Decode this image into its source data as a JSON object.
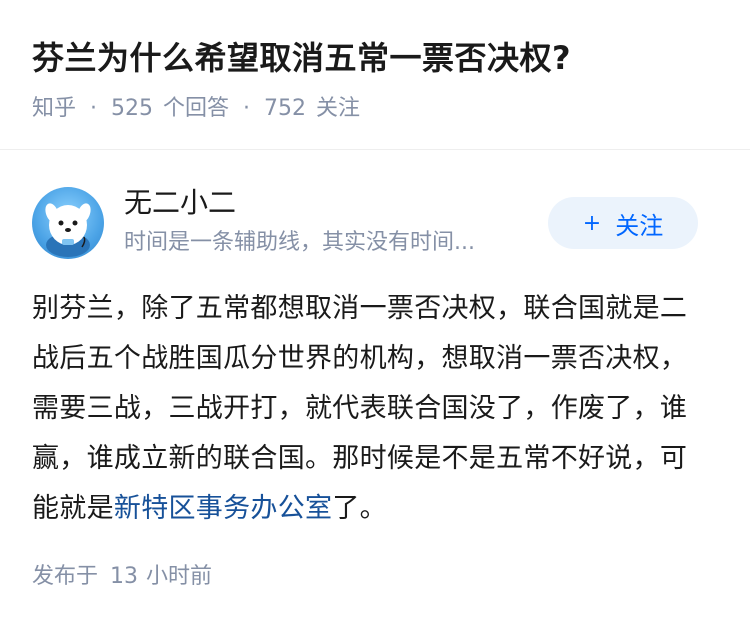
{
  "question": {
    "title": "芬兰为什么希望取消五常一票否决权?",
    "source": "知乎",
    "answer_count": "525",
    "answer_label": "个回答",
    "follow_count": "752",
    "follow_label": "关注",
    "separator": "·"
  },
  "author": {
    "name": "无二小二",
    "bio": "时间是一条辅助线，其实没有时间...",
    "avatar_icon": "cartoon-dog-avatar-icon",
    "follow_button": {
      "plus": "+",
      "label": "关注"
    }
  },
  "answer": {
    "text_before": "别芬兰，除了五常都想取消一票否决权，联合国就是二战后五个战胜国瓜分世界的机构，想取消一票否决权，需要三战，三战开打，就代表联合国没了，作废了，谁赢，谁成立新的联合国。那时候是不是五常不好说，可能就是",
    "link_text": "新特区事务办公室",
    "text_after": "了。"
  },
  "footer": {
    "published_label": "发布于",
    "time_value": "13",
    "time_unit": "小时前"
  },
  "colors": {
    "title": "#1a1a1a",
    "meta": "#8590a6",
    "accent": "#0066ff",
    "button_bg": "#ebf3fc",
    "link": "#175199"
  }
}
